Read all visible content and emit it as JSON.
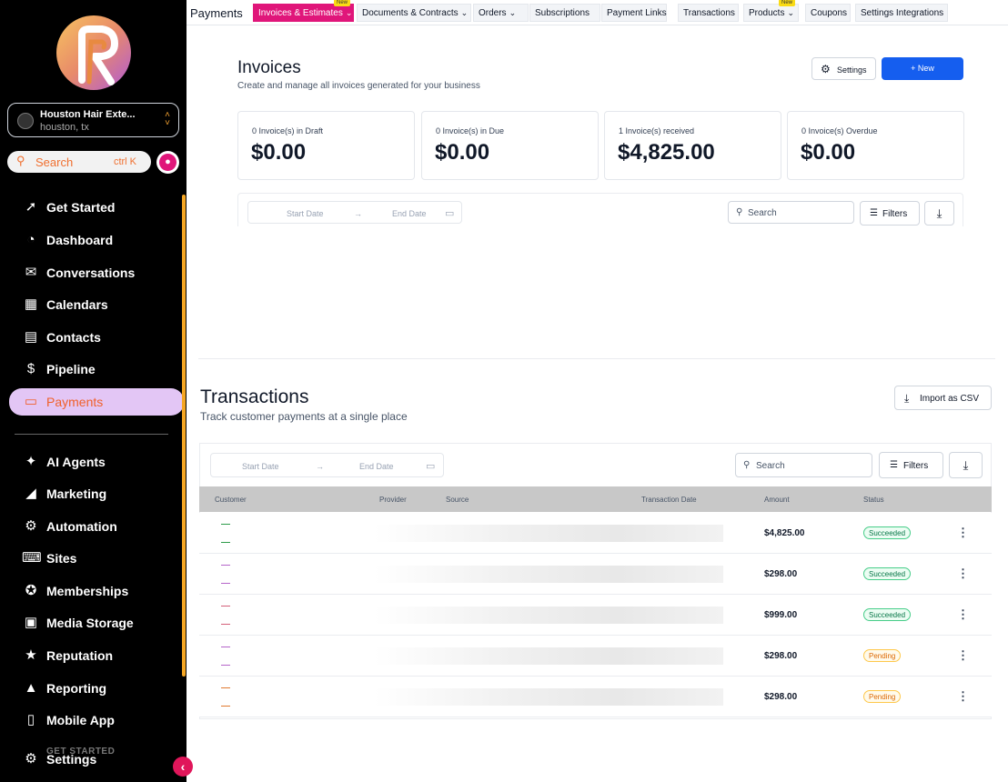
{
  "app": {
    "brand_colors": {
      "primary": "#155eef",
      "accent": "#e0167a",
      "sidebar": "#000000",
      "active_nav": "#e3c6f5"
    }
  },
  "sidebar": {
    "location": {
      "name": "Houston Hair Exte...",
      "sub": "houston, tx"
    },
    "search": {
      "placeholder": "Search",
      "shortcut": "ctrl K"
    },
    "items": [
      {
        "label": "Get Started",
        "icon": "rocket-icon"
      },
      {
        "label": "Dashboard",
        "icon": "gauge-icon"
      },
      {
        "label": "Conversations",
        "icon": "chat-icon"
      },
      {
        "label": "Calendars",
        "icon": "calendar-icon"
      },
      {
        "label": "Contacts",
        "icon": "contact-card-icon"
      },
      {
        "label": "Pipeline",
        "icon": "dollar-funnel-icon"
      },
      {
        "label": "Payments",
        "icon": "credit-card-icon",
        "active": true
      },
      {
        "label": "AI Agents",
        "icon": "sparkle-icon"
      },
      {
        "label": "Marketing",
        "icon": "megaphone-icon"
      },
      {
        "label": "Automation",
        "icon": "automation-gear-icon"
      },
      {
        "label": "Sites",
        "icon": "code-window-icon"
      },
      {
        "label": "Memberships",
        "icon": "award-icon"
      },
      {
        "label": "Media Storage",
        "icon": "image-icon"
      },
      {
        "label": "Reputation",
        "icon": "star-user-icon"
      },
      {
        "label": "Reporting",
        "icon": "chart-icon"
      },
      {
        "label": "Mobile App",
        "icon": "phone-icon"
      },
      {
        "label": "Settings",
        "icon": "settings-gear-icon"
      }
    ],
    "ghost_text": "GET STARTED"
  },
  "topbar": {
    "title": "Payments",
    "tabs": [
      {
        "label": "Invoices & Estimates",
        "dropdown": true,
        "active": true,
        "badge": "New"
      },
      {
        "label": "Documents & Contracts",
        "dropdown": true
      },
      {
        "label": "Orders",
        "dropdown": true
      },
      {
        "label": "Subscriptions"
      },
      {
        "label": "Payment Links"
      },
      {
        "label": "Transactions"
      },
      {
        "label": "Products",
        "dropdown": true,
        "badge": "New"
      },
      {
        "label": "Coupons"
      },
      {
        "label": "Settings  Integrations"
      }
    ]
  },
  "invoices": {
    "title": "Invoices",
    "subtitle": "Create and manage all invoices generated for your business",
    "settings_label": "Settings",
    "new_label": "+ New",
    "cards": [
      {
        "label": "0 Invoice(s) in Draft",
        "value": "$0.00"
      },
      {
        "label": "0 Invoice(s) in Due",
        "value": "$0.00"
      },
      {
        "label": "1 Invoice(s) received",
        "value": "$4,825.00"
      },
      {
        "label": "0 Invoice(s) Overdue",
        "value": "$0.00"
      }
    ],
    "filters": {
      "start": "Start Date",
      "end": "End Date",
      "search_placeholder": "Search",
      "filters_label": "Filters"
    }
  },
  "transactions": {
    "title": "Transactions",
    "subtitle": "Track customer payments at a single place",
    "import_label": "Import as CSV",
    "filters": {
      "start": "Start Date",
      "end": "End Date",
      "search_placeholder": "Search",
      "filters_label": "Filters"
    },
    "columns": [
      "Customer",
      "Provider",
      "Source",
      "Transaction Date",
      "Amount",
      "Status"
    ],
    "rows": [
      {
        "amount": "$4,825.00",
        "status": "Succeeded",
        "dash_color": "#2e9b4a"
      },
      {
        "amount": "$298.00",
        "status": "Succeeded",
        "dash_color": "#b565c9"
      },
      {
        "amount": "$999.00",
        "status": "Succeeded",
        "dash_color": "#d4607a"
      },
      {
        "amount": "$298.00",
        "status": "Pending",
        "dash_color": "#b565c9"
      },
      {
        "amount": "$298.00",
        "status": "Pending",
        "dash_color": "#e07a30"
      }
    ]
  }
}
